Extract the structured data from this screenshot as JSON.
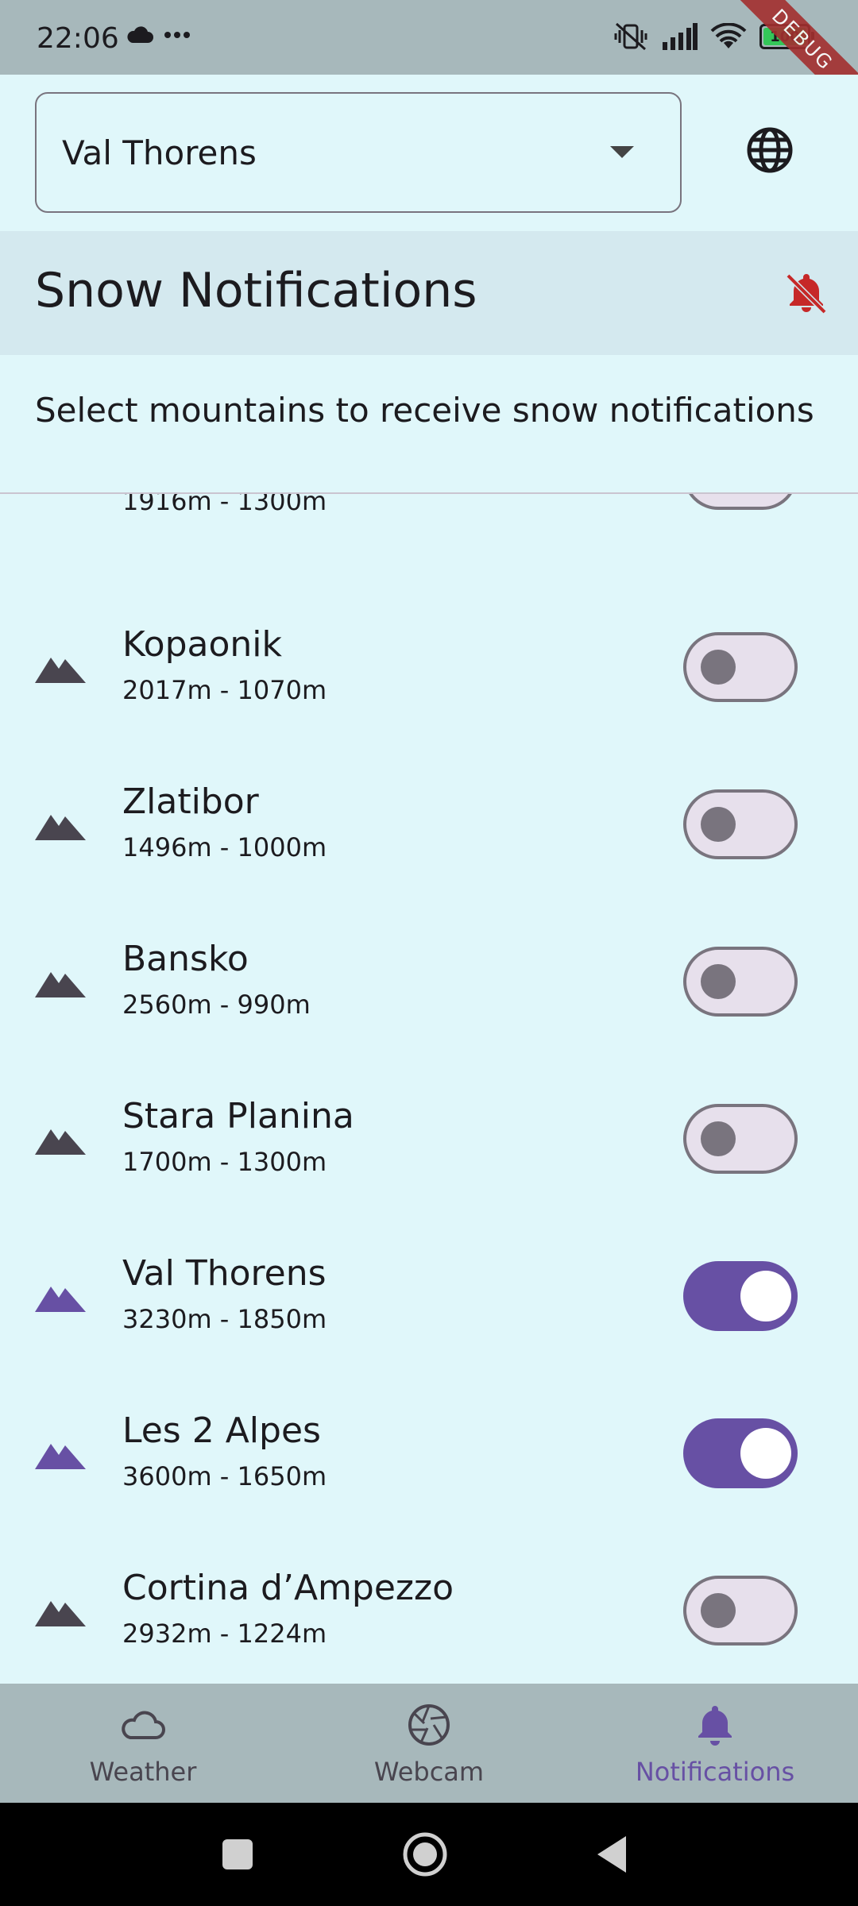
{
  "status_bar": {
    "time": "22:06",
    "battery": "100",
    "debug": "DEBUG"
  },
  "selector": {
    "value": "Val Thorens"
  },
  "header": {
    "title": "Snow Notifications"
  },
  "subtitle": "Select mountains to receive snow notifications",
  "list": {
    "partial_range": "1916m - 1300m",
    "items": [
      {
        "name": "Kopaonik",
        "range": "2017m - 1070m",
        "enabled": false
      },
      {
        "name": "Zlatibor",
        "range": "1496m - 1000m",
        "enabled": false
      },
      {
        "name": "Bansko",
        "range": "2560m - 990m",
        "enabled": false
      },
      {
        "name": "Stara Planina",
        "range": "1700m - 1300m",
        "enabled": false
      },
      {
        "name": "Val Thorens",
        "range": "3230m - 1850m",
        "enabled": true
      },
      {
        "name": "Les 2 Alpes",
        "range": "3600m - 1650m",
        "enabled": true
      },
      {
        "name": "Cortina d’Ampezzo",
        "range": "2932m - 1224m",
        "enabled": false
      }
    ]
  },
  "bottom_nav": {
    "weather": "Weather",
    "webcam": "Webcam",
    "notifications": "Notifications",
    "active": "notifications"
  },
  "colors": {
    "accent": "#6750A4",
    "background": "#E0F7FA",
    "header": "#D4E9EF",
    "bell_off": "#C62828",
    "nav": "#A7B8BB"
  }
}
